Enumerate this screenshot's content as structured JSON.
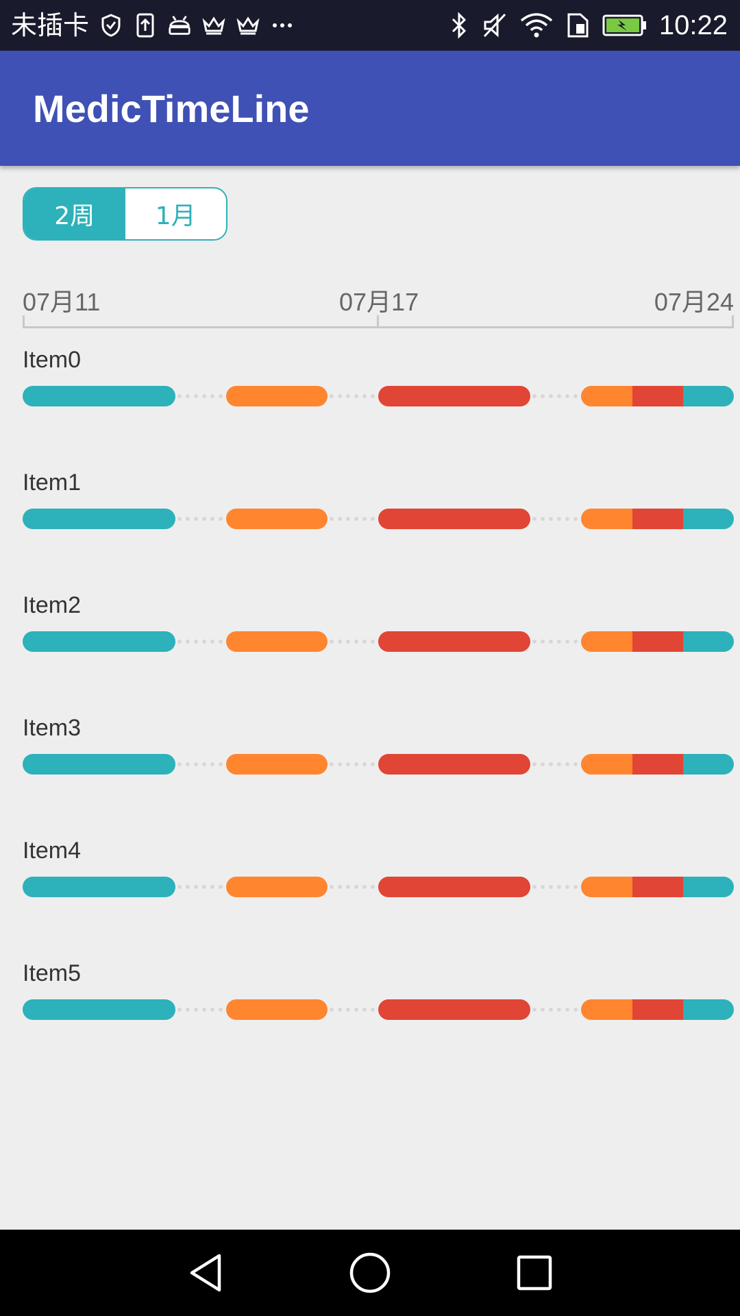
{
  "status_bar": {
    "carrier": "未插卡",
    "time": "10:22",
    "left_icons": [
      "shield-check-icon",
      "upload-icon",
      "android-icon",
      "crown-icon",
      "crown-icon",
      "more-icon"
    ],
    "right_icons": [
      "bluetooth-icon",
      "mute-icon",
      "wifi-icon",
      "sim-icon",
      "battery-charging-icon"
    ]
  },
  "app_bar": {
    "title": "MedicTimeLine",
    "color": "#3f51b5"
  },
  "segment": {
    "options": [
      {
        "label": "2周",
        "selected": true
      },
      {
        "label": "1月",
        "selected": false
      }
    ],
    "accent": "#2db1ba"
  },
  "axis": {
    "labels": [
      "07月11",
      "07月17",
      "07月24"
    ]
  },
  "colors": {
    "teal": "#2db1ba",
    "orange": "#ff852f",
    "red": "#e04535"
  },
  "items": [
    {
      "label": "Item0"
    },
    {
      "label": "Item1"
    },
    {
      "label": "Item2"
    },
    {
      "label": "Item3"
    },
    {
      "label": "Item4"
    },
    {
      "label": "Item5"
    }
  ],
  "nav": [
    "back-icon",
    "home-icon",
    "recents-icon"
  ]
}
